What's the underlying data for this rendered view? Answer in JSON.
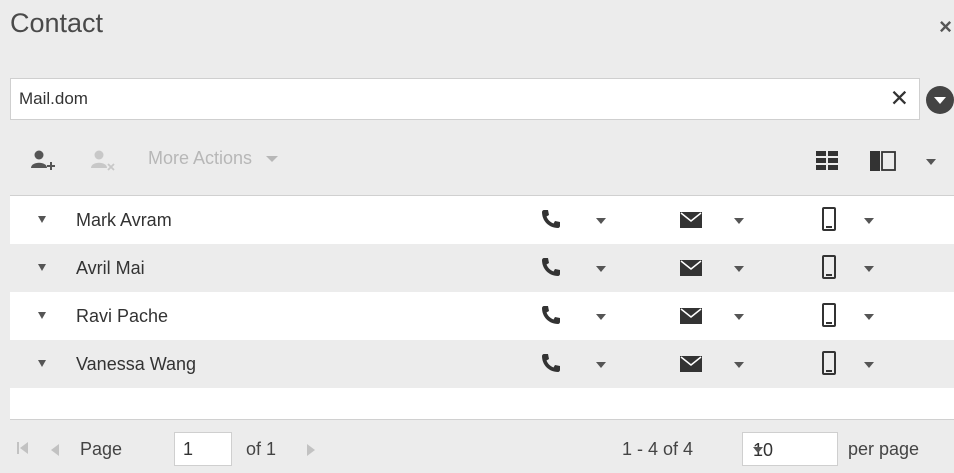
{
  "header": {
    "title": "Contact",
    "close_label": "×"
  },
  "search": {
    "value": "Mail.dom",
    "placeholder": "",
    "clear_label": "✕"
  },
  "toolbar": {
    "more_actions_label": "More Actions"
  },
  "contacts": [
    {
      "name": "Mark Avram"
    },
    {
      "name": "Avril Mai"
    },
    {
      "name": "Ravi Pache"
    },
    {
      "name": "Vanessa Wang"
    }
  ],
  "footer": {
    "page_label": "Page",
    "page_value": "1",
    "of_label": "of 1",
    "range_label": "1 - 4 of 4",
    "per_page_value": "10",
    "per_page_label": "per page"
  },
  "colors": {
    "background": "#ececec",
    "icon": "#555555",
    "disabled": "#b7b7b7"
  },
  "icons": [
    "add-contact-icon",
    "delete-contact-icon",
    "grid-view-icon",
    "panel-view-icon",
    "phone-icon",
    "envelope-icon",
    "mobile-icon"
  ]
}
